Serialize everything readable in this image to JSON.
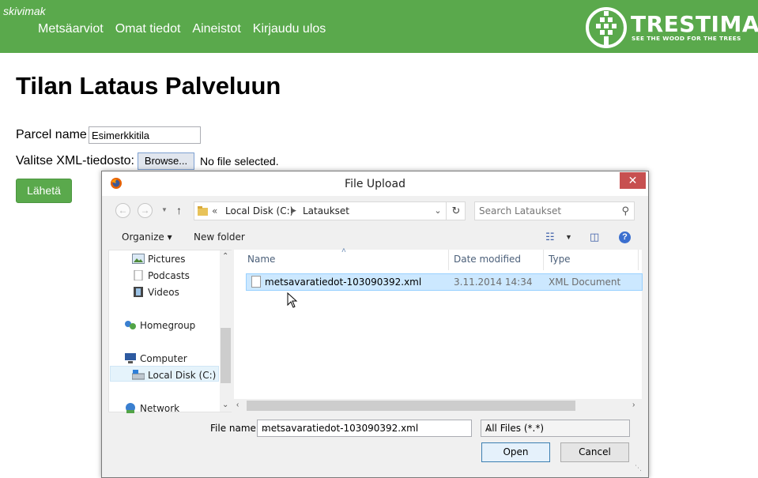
{
  "header": {
    "username": "skivimak",
    "nav": [
      "Metsäarviot",
      "Omat tiedot",
      "Aineistot",
      "Kirjaudu ulos"
    ],
    "logo_brand": "TRESTIMA",
    "logo_tagline": "SEE THE WOOD FOR THE TREES"
  },
  "page": {
    "title": "Tilan Lataus Palveluun",
    "parcel_label": "Parcel name",
    "parcel_value": "Esimerkkitila",
    "xml_label": "Valitse XML-tiedosto:",
    "browse_label": "Browse...",
    "no_file_text": "No file selected.",
    "submit_label": "Lähetä"
  },
  "dialog": {
    "title": "File Upload",
    "close_label": "✕",
    "breadcrumb": {
      "prefix": "«",
      "items": [
        "Local Disk (C:)",
        "Lataukset"
      ]
    },
    "search_placeholder": "Search Lataukset",
    "toolbar": {
      "organize": "Organize ▾",
      "new_folder": "New folder"
    },
    "nav_items": [
      "Pictures",
      "Podcasts",
      "Videos",
      "Homegroup",
      "Computer",
      "Local Disk (C:)",
      "Network"
    ],
    "columns": [
      "Name",
      "Date modified",
      "Type"
    ],
    "files": [
      {
        "name": "metsavaratiedot-103090392.xml",
        "date": "3.11.2014 14:34",
        "type": "XML Document"
      }
    ],
    "filename_label": "File name:",
    "filename_value": "metsavaratiedot-103090392.xml",
    "filetype_value": "All Files (*.*)",
    "open_label": "Open",
    "cancel_label": "Cancel"
  },
  "colors": {
    "brand_green": "#5aa94c",
    "selection_blue": "#cce8ff",
    "close_red": "#c75050"
  }
}
